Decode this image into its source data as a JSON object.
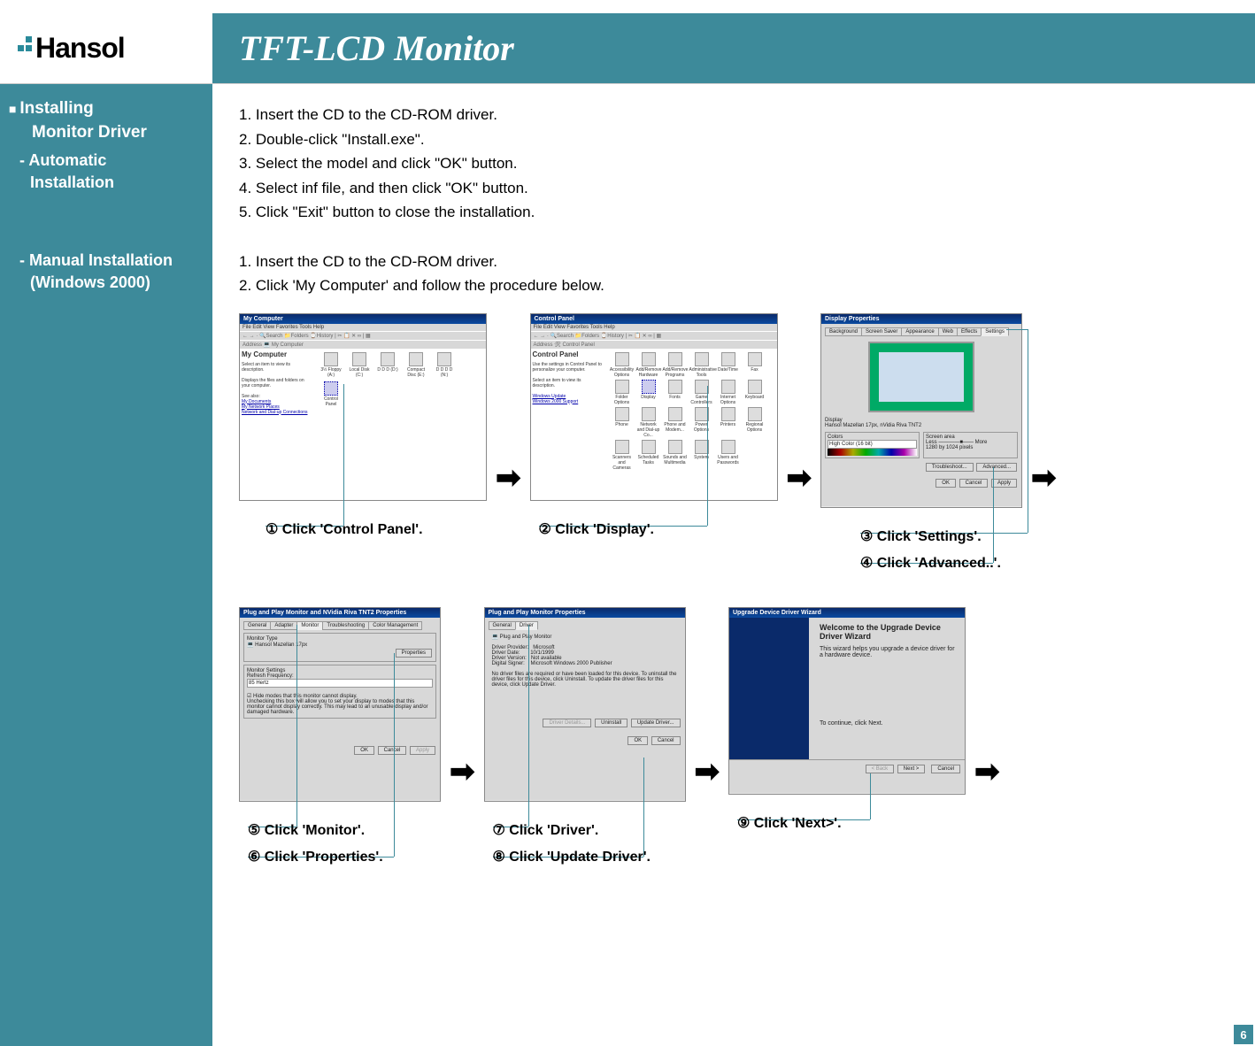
{
  "brand": "Hansol",
  "pageTitle": "TFT-LCD Monitor",
  "pageNumber": "6",
  "sidebar": {
    "heading1": "Installing",
    "heading2": "Monitor Driver",
    "sub1a": "- Automatic",
    "sub1b": "Installation",
    "sub2a": "- Manual Installation",
    "sub2b": "(Windows 2000)"
  },
  "auto": {
    "s1": "1. Insert the CD to the CD-ROM driver.",
    "s2": "2. Double-click \"Install.exe\".",
    "s3": "3. Select the model and click \"OK\" button.",
    "s4": "4. Select inf file, and then click \"OK\" button.",
    "s5": "5. Click \"Exit\" button to close the installation."
  },
  "manual": {
    "s1": "1. Insert the CD to the CD-ROM driver.",
    "s2": "2. Click 'My Computer' and follow the procedure below."
  },
  "captions": {
    "c1": "① Click 'Control Panel'.",
    "c2": "② Click 'Display'.",
    "c3": "③ Click 'Settings'.",
    "c4": "④ Click 'Advanced..'.",
    "c5": "⑤ Click 'Monitor'.",
    "c6": "⑥ Click 'Properties'.",
    "c7": "⑦ Click 'Driver'.",
    "c8": "⑧ Click 'Update Driver'.",
    "c9": "⑨ Click 'Next>'."
  },
  "thumbs": {
    "t1": {
      "winTitle": "My Computer",
      "leftTitle": "My Computer",
      "highlight": "Control Panel"
    },
    "t2": {
      "winTitle": "Control Panel",
      "leftTitle": "Control Panel",
      "highlight": "Display",
      "icons": [
        "Accessibility Options",
        "Add/Remove Hardware",
        "Add/Remove Programs",
        "Administrative Tools",
        "Date/Time",
        "Fax",
        "Folder Options",
        "Display",
        "Fonts",
        "Game Controllers",
        "Internet Options",
        "Keyboard",
        "Phone",
        "Network and Dial-up Co...",
        "Phone and Modem...",
        "Power Options",
        "Printers",
        "Regional Options",
        "Scanners and Cameras",
        "Scheduled Tasks",
        "Sounds and Multimedia",
        "System",
        "Users and Passwords"
      ]
    },
    "t3": {
      "winTitle": "Display Properties",
      "tabs": [
        "Background",
        "Screen Saver",
        "Appearance",
        "Web",
        "Effects",
        "Settings"
      ],
      "display": "Hansol  Mazellan 17px, nVidia Riva TNT2",
      "color": "High Color (16 bit)",
      "res": "1280 by 1024 pixels",
      "btns": [
        "OK",
        "Cancel",
        "Apply"
      ],
      "adv": "Advanced..."
    },
    "t4": {
      "winTitle": "Plug and Play Monitor and NVidia Riva TNT2 Properties",
      "tabs": [
        "General",
        "Adapter",
        "Monitor",
        "Troubleshooting",
        "Color Management"
      ],
      "monType": "Hansol Mazellan 17px",
      "prop": "Properties",
      "refresh": "85 Hertz",
      "hide": "Hide modes that this monitor cannot display.",
      "note": "Unchecking this box will allow you to set your display to modes that this monitor cannot display correctly. This may lead to an unusable display and/or damaged hardware.",
      "btns": [
        "OK",
        "Cancel",
        "Apply"
      ]
    },
    "t5": {
      "winTitle": "Plug and Play Monitor Properties",
      "tabs": [
        "General",
        "Driver"
      ],
      "name": "Plug and Play Monitor",
      "provider": "Microsoft",
      "date": "10/1/1999",
      "version": "Not available",
      "signer": "Microsoft Windows 2000 Publisher",
      "note": "No driver files are required or have been loaded for this device. To uninstall the driver files for this device, click Uninstall. To update the driver files for this device, click Update Driver.",
      "btns": [
        "Uninstall",
        "Update Driver..."
      ],
      "ok": "OK",
      "cancel": "Cancel"
    },
    "t6": {
      "winTitle": "Upgrade Device Driver Wizard",
      "heading": "Welcome to the Upgrade Device Driver Wizard",
      "sub": "This wizard helps you upgrade a device driver for a hardware device.",
      "cont": "To continue, click Next.",
      "btns": [
        "< Back",
        "Next >",
        "Cancel"
      ]
    }
  }
}
